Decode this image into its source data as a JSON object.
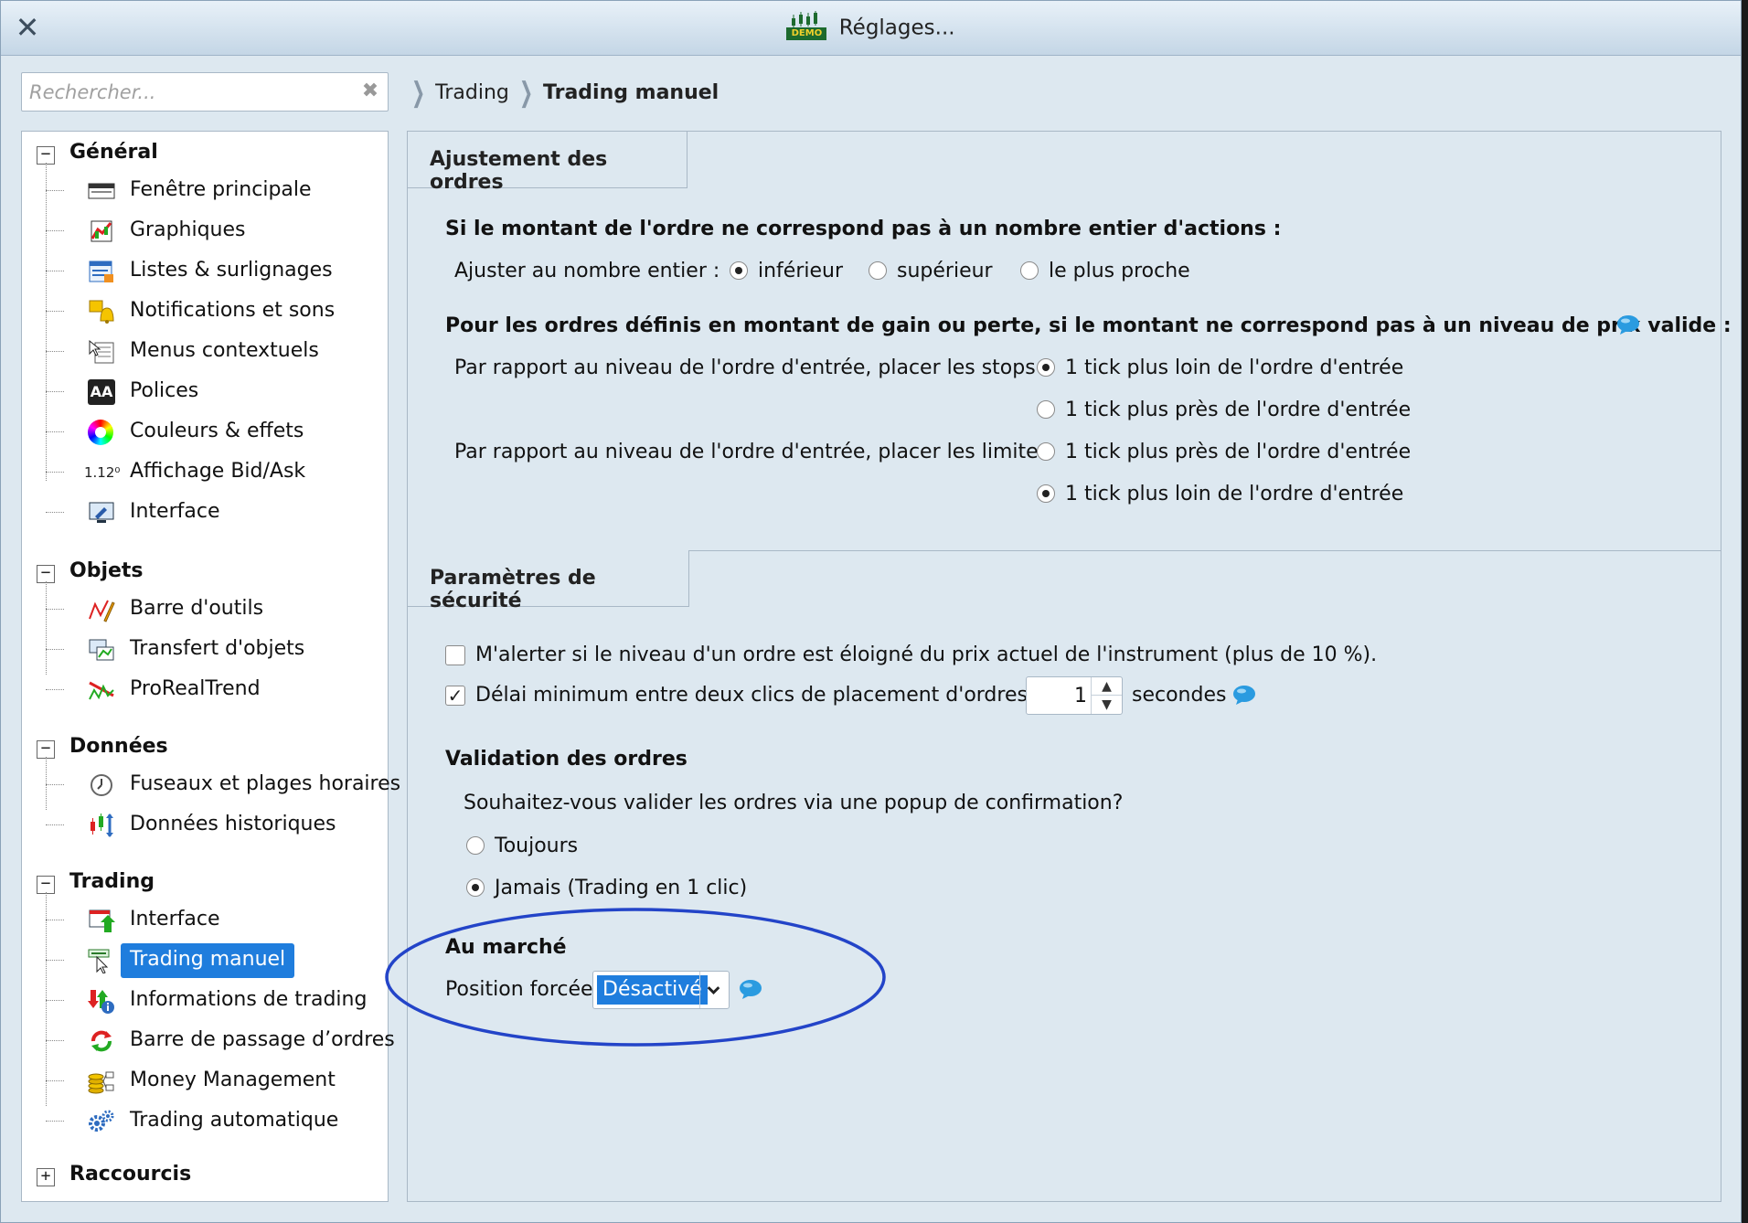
{
  "window": {
    "title": "Réglages...",
    "logo_text": "DEMO"
  },
  "search": {
    "placeholder": "Rechercher..."
  },
  "breadcrumb": [
    "Trading",
    "Trading manuel"
  ],
  "tree": {
    "groups": [
      {
        "label": "Général",
        "toggle": "−",
        "items": [
          "Fenêtre principale",
          "Graphiques",
          "Listes & surlignages",
          "Notifications et sons",
          "Menus contextuels",
          "Polices",
          "Couleurs & effets",
          "Affichage Bid/Ask",
          "Interface"
        ]
      },
      {
        "label": "Objets",
        "toggle": "−",
        "items": [
          "Barre d'outils",
          "Transfert d'objets",
          "ProRealTrend"
        ]
      },
      {
        "label": "Données",
        "toggle": "−",
        "items": [
          "Fuseaux et plages horaires",
          "Données historiques"
        ]
      },
      {
        "label": "Trading",
        "toggle": "−",
        "items": [
          "Interface",
          "Trading manuel",
          "Informations de trading",
          "Barre de passage d’ordres",
          "Money Management",
          "Trading automatique"
        ]
      },
      {
        "label": "Raccourcis",
        "toggle": "+",
        "items": []
      }
    ],
    "selected": "Trading manuel",
    "bid_ask_icon_text": "1.12⁰",
    "polices_icon_text": "AA"
  },
  "adjust": {
    "tab_label": "Ajustement des ordres",
    "q1": "Si le montant de l'ordre ne correspond pas à un nombre entier d'actions :",
    "q1_label": "Ajuster au nombre entier :",
    "q1_options": [
      "inférieur",
      "supérieur",
      "le plus proche"
    ],
    "q1_selected": "inférieur",
    "q2": "Pour les ordres définis en montant de gain ou perte, si le montant ne correspond pas à un niveau de prix valide :",
    "stops_label": "Par rapport au niveau de l'ordre d'entrée, placer les stops",
    "stops_options": [
      "1 tick plus loin de l'ordre d'entrée",
      "1 tick plus près de l'ordre d'entrée"
    ],
    "stops_selected": "1 tick plus loin de l'ordre d'entrée",
    "limits_label": "Par rapport au niveau de l'ordre d'entrée, placer les limites",
    "limits_options": [
      "1 tick plus près de l'ordre d'entrée",
      "1 tick plus loin de l'ordre d'entrée"
    ],
    "limits_selected": "1 tick plus loin de l'ordre d'entrée"
  },
  "security": {
    "tab_label": "Paramètres de sécurité",
    "alert_label": "M'alerter si le niveau d'un ordre est éloigné du prix actuel de l'instrument (plus de 10 %).",
    "alert_checked": false,
    "delay_label": "Délai minimum entre deux clics de placement d'ordres :",
    "delay_checked": true,
    "delay_value": "1",
    "delay_unit": "secondes",
    "validation_title": "Validation des ordres",
    "validation_question": "Souhaitez-vous valider les ordres via une popup de confirmation?",
    "validation_options": [
      "Toujours",
      "Jamais (Trading en 1 clic)"
    ],
    "validation_selected": "Jamais (Trading en 1 clic)",
    "market_title": "Au marché",
    "forced_label": "Position forcée",
    "forced_value": "Désactivé"
  },
  "colors": {
    "accent": "#1f7ddd",
    "highlight_ellipse": "#2344c8",
    "help_bubble": "#2a9be0"
  }
}
